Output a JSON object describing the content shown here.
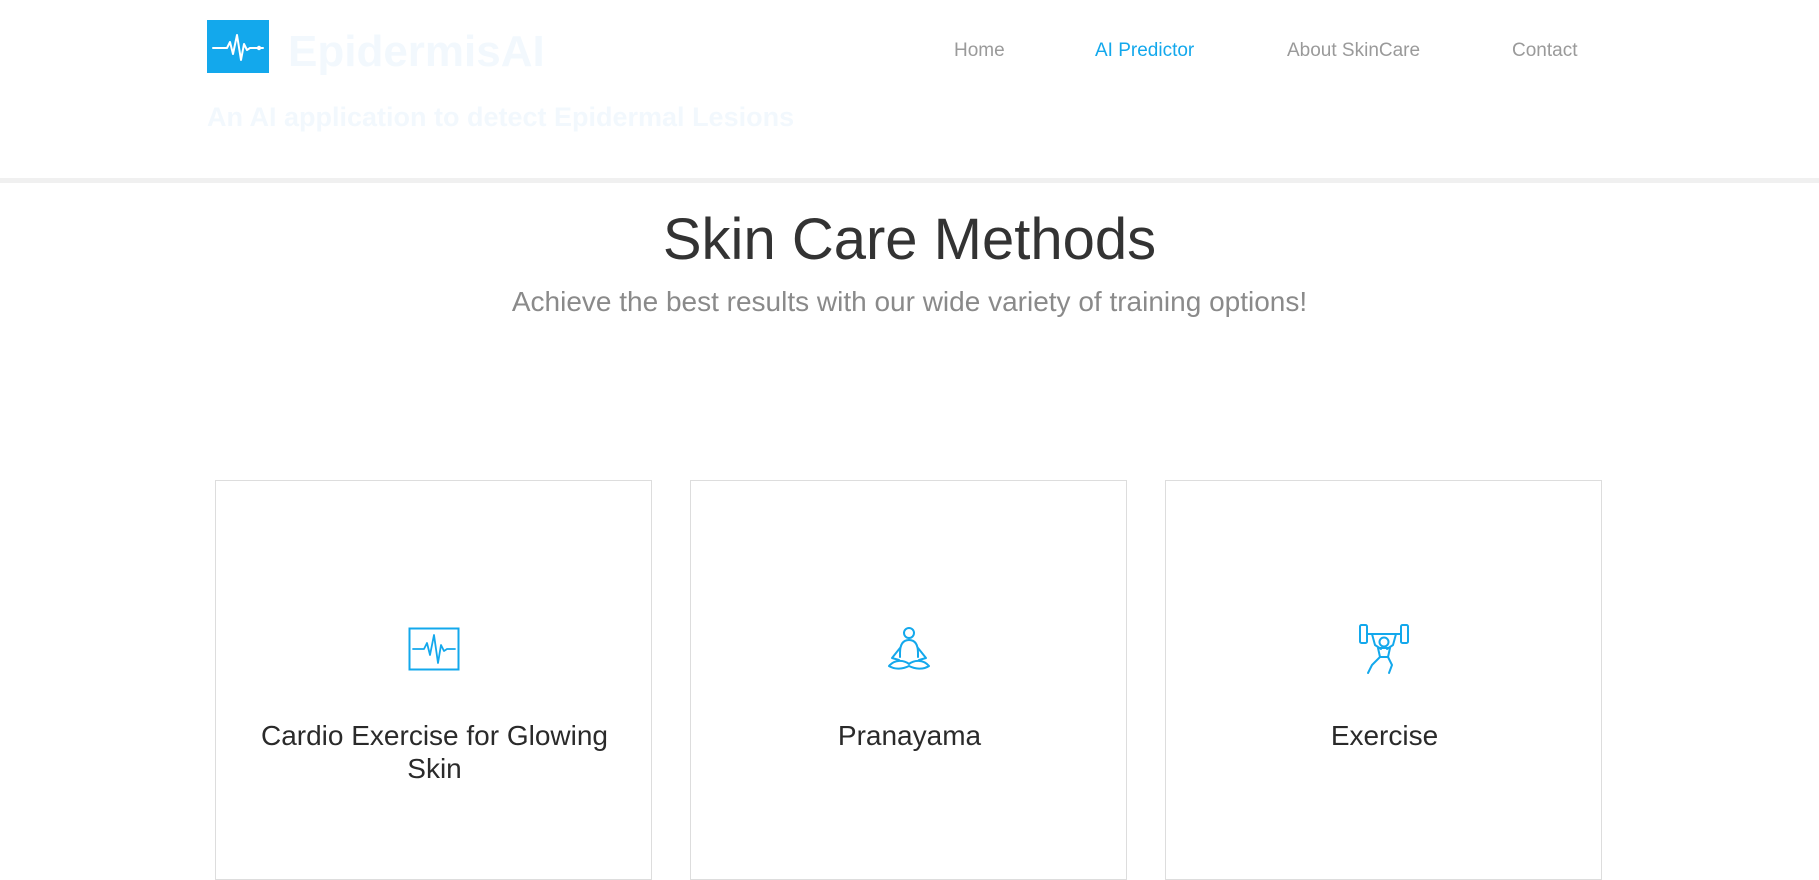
{
  "brand": {
    "name": "EpidermisAI",
    "tagline": "An AI application to detect Epidermal Lesions",
    "logo_icon": "heartbeat-icon",
    "logo_color": "#13a8ec"
  },
  "nav": {
    "items": [
      {
        "label": "Home",
        "active": false
      },
      {
        "label": "AI Predictor",
        "active": true
      },
      {
        "label": "About SkinCare",
        "active": false
      },
      {
        "label": "Contact",
        "active": false
      }
    ]
  },
  "section": {
    "title": "Skin Care Methods",
    "subtitle": "Achieve the best results with our wide variety of training options!"
  },
  "cards": [
    {
      "icon": "heartbeat-monitor-icon",
      "title": "Cardio Exercise for Glowing Skin"
    },
    {
      "icon": "meditation-icon",
      "title": "Pranayama"
    },
    {
      "icon": "weightlifting-icon",
      "title": "Exercise"
    }
  ],
  "colors": {
    "accent": "#13a8ec",
    "title": "#333333",
    "subtitle": "#8a8a8a",
    "nav_inactive": "#9a9a9a"
  }
}
